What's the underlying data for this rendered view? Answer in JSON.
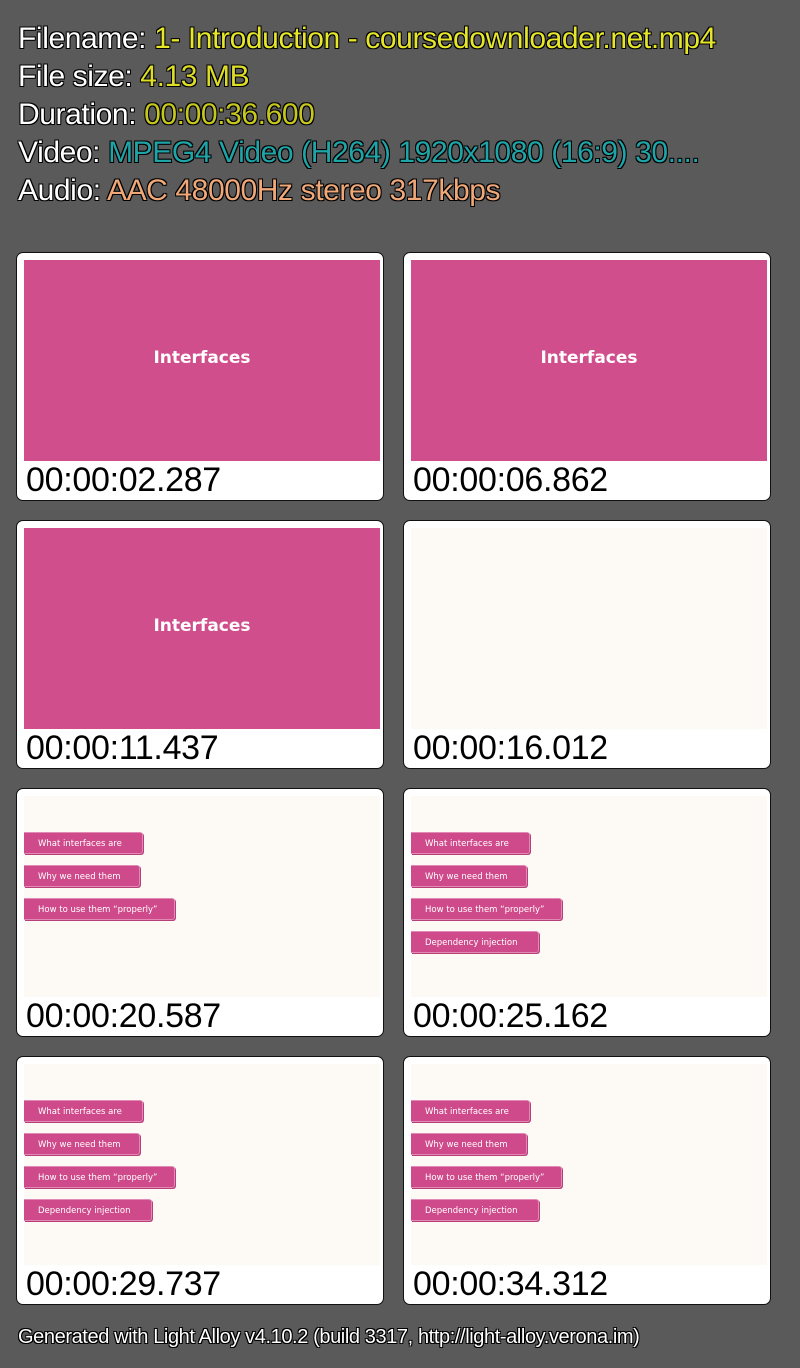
{
  "info": {
    "filename_label": "Filename: ",
    "filename": "1- Introduction - coursedownloader.net.mp4",
    "filesize_label": "File size: ",
    "filesize": "4.13 MB",
    "duration_label": "Duration: ",
    "duration": "00:00:36.600",
    "video_label": "Video: ",
    "video": "MPEG4 Video (H264) 1920x1080 (16:9) 30....",
    "audio_label": "Audio: ",
    "audio": "AAC 48000Hz stereo 317kbps"
  },
  "thumbnails": [
    {
      "timestamp": "00:00:02.287",
      "type": "title",
      "title": "Interfaces",
      "items": []
    },
    {
      "timestamp": "00:00:06.862",
      "type": "title",
      "title": "Interfaces",
      "items": []
    },
    {
      "timestamp": "00:00:11.437",
      "type": "title",
      "title": "Interfaces",
      "items": []
    },
    {
      "timestamp": "00:00:16.012",
      "type": "blank",
      "title": "",
      "items": []
    },
    {
      "timestamp": "00:00:20.587",
      "type": "list",
      "title": "",
      "items": [
        "What interfaces are",
        "Why we need them",
        "How to use them “properly”"
      ]
    },
    {
      "timestamp": "00:00:25.162",
      "type": "list",
      "title": "",
      "items": [
        "What interfaces are",
        "Why we need them",
        "How to use them “properly”",
        "Dependency injection"
      ]
    },
    {
      "timestamp": "00:00:29.737",
      "type": "list",
      "title": "",
      "items": [
        "What interfaces are",
        "Why we need them",
        "How to use them “properly”",
        "Dependency injection"
      ]
    },
    {
      "timestamp": "00:00:34.312",
      "type": "list",
      "title": "",
      "items": [
        "What interfaces are",
        "Why we need them",
        "How to use them “properly”",
        "Dependency injection"
      ]
    }
  ],
  "footer": "Generated with Light Alloy v4.10.2 (build 3317, http://light-alloy.verona.im)",
  "colors": {
    "background": "#5a5a5a",
    "slide_pink": "#d14e8d",
    "slide_cream": "#fdfaf5",
    "filename": "#e6e62a",
    "video": "#1fa4a8",
    "audio": "#f0a878"
  }
}
